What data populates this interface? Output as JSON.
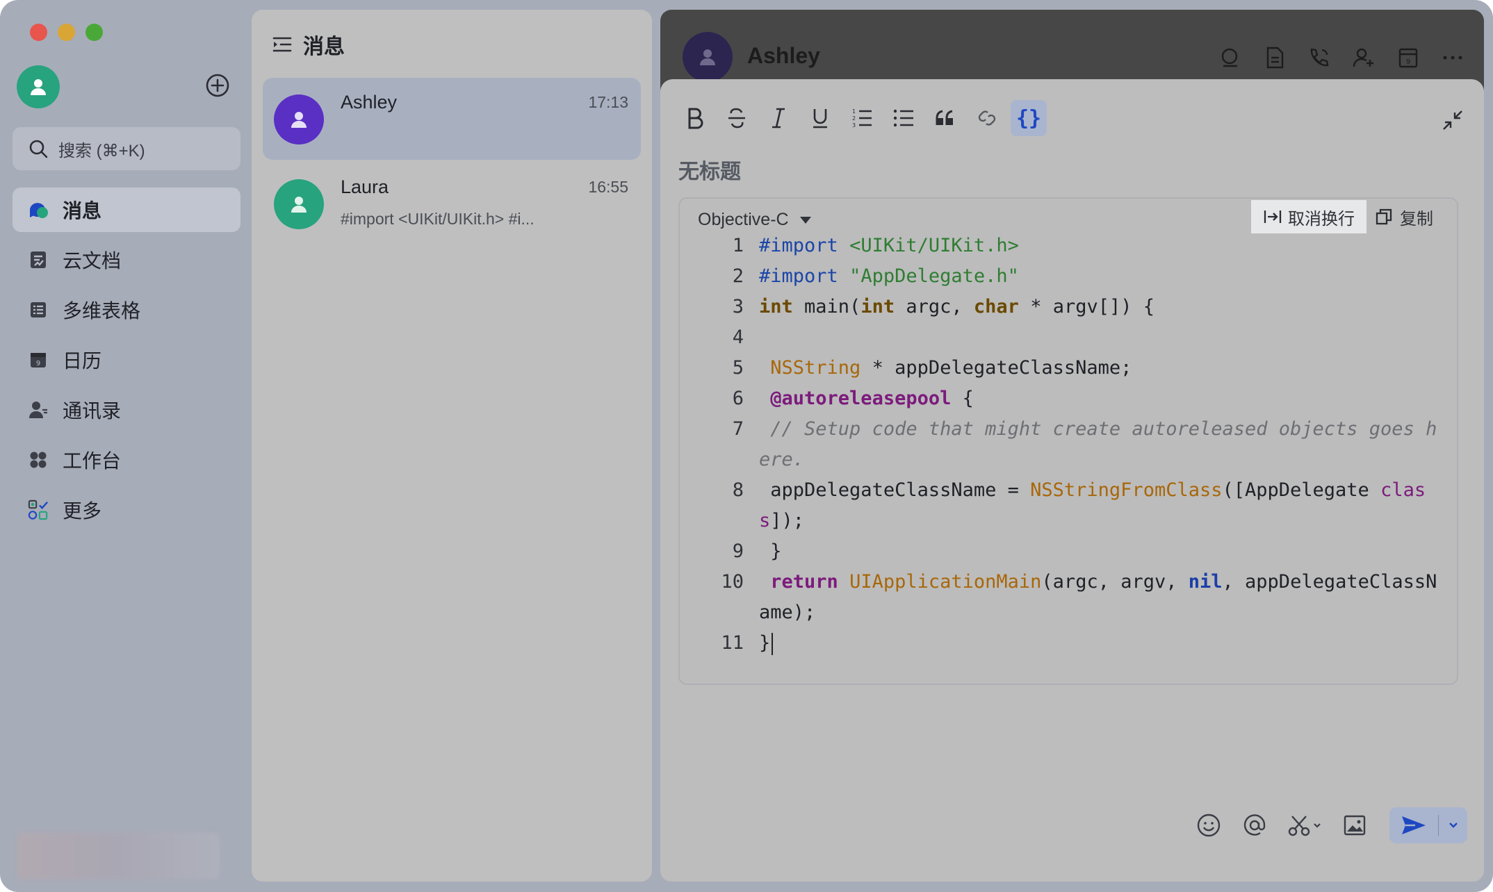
{
  "window": {
    "colors": {
      "accent": "#1e47c2",
      "online_green": "#27a37e",
      "ashley_purple": "#5a2fc4"
    }
  },
  "sidebar": {
    "search_placeholder": "搜索 (⌘+K)",
    "items": [
      {
        "label": "消息",
        "icon": "message-icon",
        "active": true
      },
      {
        "label": "云文档",
        "icon": "docs-icon"
      },
      {
        "label": "多维表格",
        "icon": "table-icon"
      },
      {
        "label": "日历",
        "icon": "calendar-icon"
      },
      {
        "label": "通讯录",
        "icon": "contacts-icon"
      },
      {
        "label": "工作台",
        "icon": "workplace-icon"
      },
      {
        "label": "更多",
        "icon": "more-apps-icon"
      }
    ]
  },
  "message_list": {
    "title": "消息",
    "conversations": [
      {
        "name": "Ashley",
        "time": "17:13",
        "preview": "",
        "active": true
      },
      {
        "name": "Laura",
        "time": "16:55",
        "preview": "#import <UIKit/UIKit.h> #i..."
      }
    ]
  },
  "chat": {
    "name": "Ashley",
    "doc_title": "无标题",
    "code_block": {
      "language": "Objective-C",
      "unwrap_label": "取消换行",
      "copy_label": "复制",
      "line_numbers": [
        "1",
        "2",
        "3",
        "4",
        "5",
        "6",
        "7",
        "8",
        "9",
        "10",
        "11"
      ]
    }
  }
}
